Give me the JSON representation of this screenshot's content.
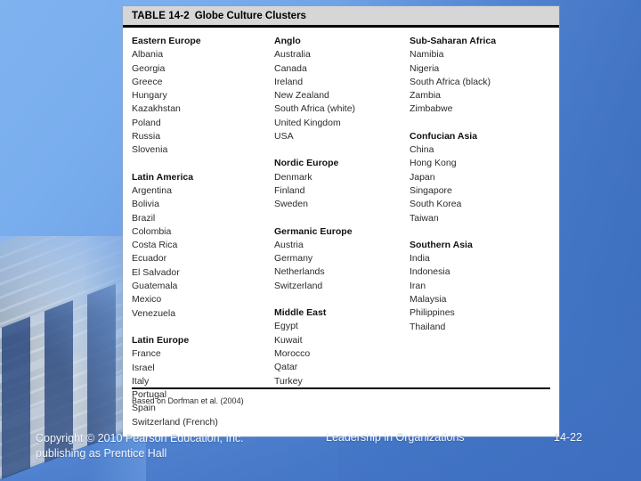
{
  "slide": {
    "background_top_color": "#7fb2ef",
    "background_bottom_color": "#4678c8"
  },
  "table": {
    "number_label": "TABLE 14-2",
    "title": "Globe Culture Clusters",
    "source_note": "Based on Dorfman et al. (2004)",
    "columns": [
      {
        "clusters": [
          {
            "name": "Eastern Europe",
            "countries": [
              "Albania",
              "Georgia",
              "Greece",
              "Hungary",
              "Kazakhstan",
              "Poland",
              "Russia",
              "Slovenia"
            ]
          },
          {
            "name": "Latin America",
            "countries": [
              "Argentina",
              "Bolivia",
              "Brazil",
              "Colombia",
              "Costa Rica",
              "Ecuador",
              "El Salvador",
              "Guatemala",
              "Mexico",
              "Venezuela"
            ]
          },
          {
            "name": "Latin Europe",
            "countries": [
              "France",
              "Israel",
              "Italy",
              "Portugal",
              "Spain",
              "Switzerland (French)"
            ]
          }
        ]
      },
      {
        "clusters": [
          {
            "name": "Anglo",
            "countries": [
              "Australia",
              "Canada",
              "Ireland",
              "New Zealand",
              "South Africa (white)",
              "United Kingdom",
              "USA"
            ]
          },
          {
            "name": "Nordic Europe",
            "countries": [
              "Denmark",
              "Finland",
              "Sweden"
            ]
          },
          {
            "name": "Germanic Europe",
            "countries": [
              "Austria",
              "Germany",
              "Netherlands",
              "Switzerland"
            ]
          },
          {
            "name": "Middle East",
            "countries": [
              "Egypt",
              "Kuwait",
              "Morocco",
              "Qatar",
              "Turkey"
            ]
          }
        ]
      },
      {
        "clusters": [
          {
            "name": "Sub-Saharan Africa",
            "countries": [
              "Namibia",
              "Nigeria",
              "South Africa (black)",
              "Zambia",
              "Zimbabwe"
            ]
          },
          {
            "name": "Confucian Asia",
            "countries": [
              "China",
              "Hong Kong",
              "Japan",
              "Singapore",
              "South Korea",
              "Taiwan"
            ]
          },
          {
            "name": "Southern Asia",
            "countries": [
              "India",
              "Indonesia",
              "Iran",
              "Malaysia",
              "Philippines",
              "Thailand"
            ]
          }
        ]
      }
    ]
  },
  "footer": {
    "copyright_line_1": "Copyright © 2010 Pearson Education, Inc.",
    "copyright_line_2": "publishing as Prentice Hall",
    "book_title": "Leadership in Organizations",
    "slide_number": "14-22"
  }
}
